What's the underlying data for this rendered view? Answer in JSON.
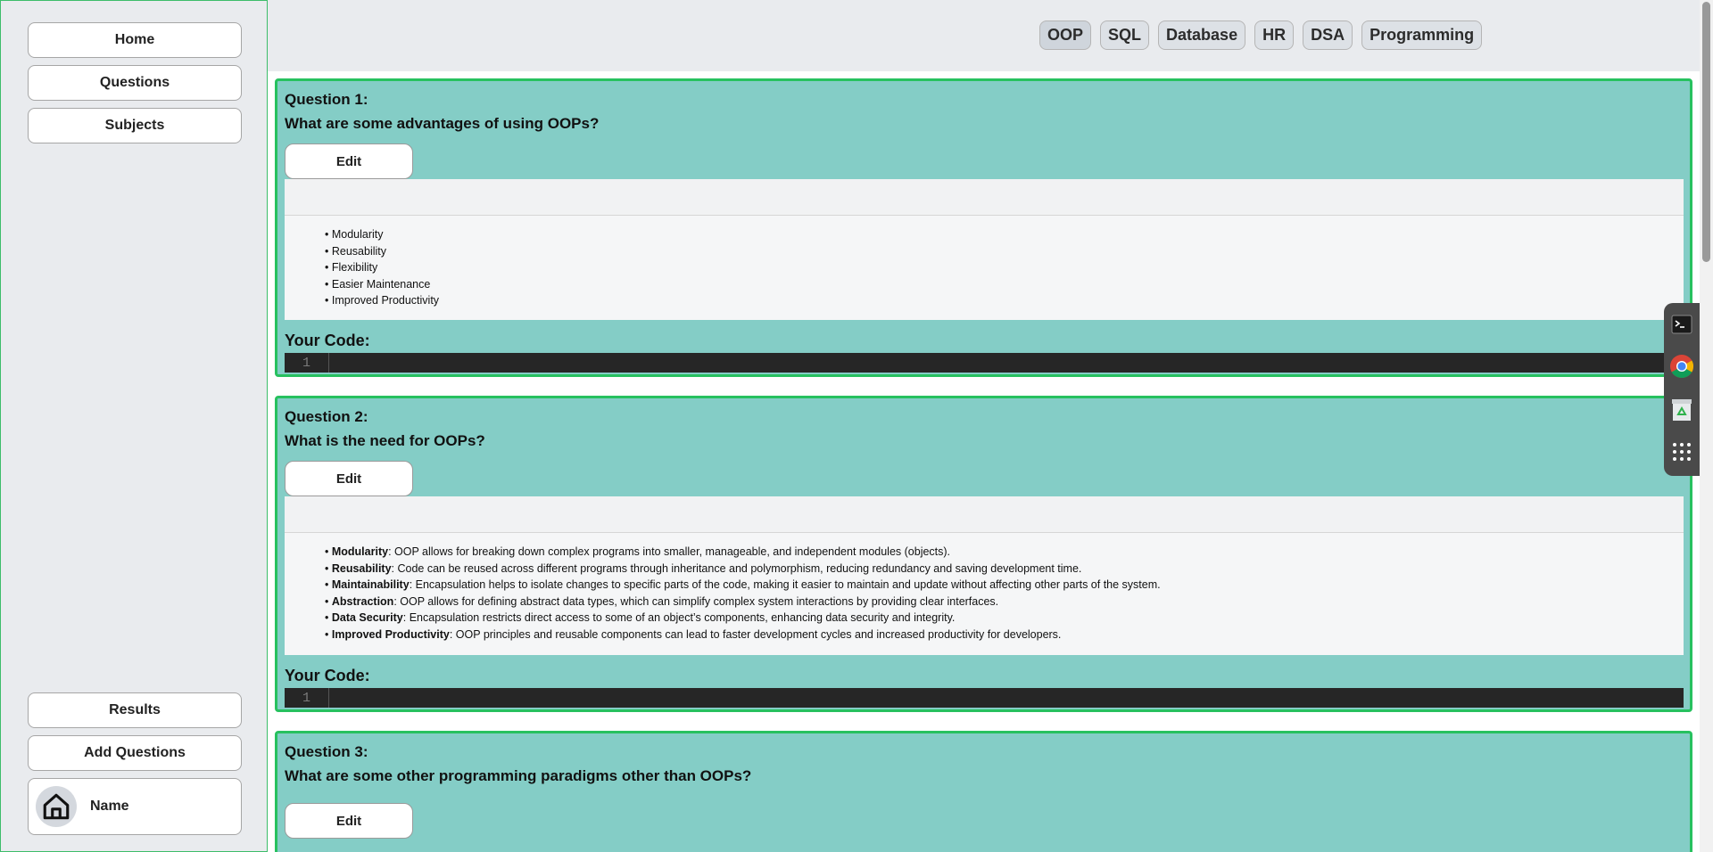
{
  "sidebar": {
    "top_items": [
      "Home",
      "Questions",
      "Subjects"
    ],
    "bottom_items": [
      "Results",
      "Add Questions"
    ],
    "profile": {
      "name": "Name",
      "icon": "home-icon"
    }
  },
  "subject_tabs": {
    "items": [
      "OOP",
      "SQL",
      "Database",
      "HR",
      "DSA",
      "Programming"
    ],
    "active": "OOP"
  },
  "questions": [
    {
      "title": "Question 1:",
      "text": "What are some advantages of using OOPs?",
      "edit_label": "Edit",
      "answers": [
        {
          "term": "",
          "desc": "Modularity"
        },
        {
          "term": "",
          "desc": "Reusability"
        },
        {
          "term": "",
          "desc": "Flexibility"
        },
        {
          "term": "",
          "desc": "Easier Maintenance"
        },
        {
          "term": "",
          "desc": "Improved Productivity"
        }
      ],
      "code_label": "Your Code:",
      "line_number": "1"
    },
    {
      "title": "Question 2:",
      "text": "What is the need for OOPs?",
      "edit_label": "Edit",
      "answers": [
        {
          "term": "Modularity",
          "desc": ": OOP allows for breaking down complex programs into smaller, manageable, and independent modules (objects)."
        },
        {
          "term": "Reusability",
          "desc": ": Code can be reused across different programs through inheritance and polymorphism, reducing redundancy and saving development time."
        },
        {
          "term": "Maintainability",
          "desc": ": Encapsulation helps to isolate changes to specific parts of the code, making it easier to maintain and update without affecting other parts of the system."
        },
        {
          "term": "Abstraction",
          "desc": ": OOP allows for defining abstract data types, which can simplify complex system interactions by providing clear interfaces."
        },
        {
          "term": "Data Security",
          "desc": ": Encapsulation restricts direct access to some of an object’s components, enhancing data security and integrity."
        },
        {
          "term": "Improved Productivity",
          "desc": ": OOP principles and reusable components can lead to faster development cycles and increased productivity for developers."
        }
      ],
      "code_label": "Your Code:",
      "line_number": "1"
    },
    {
      "title": "Question 3:",
      "text": "What are some other programming paradigms other than OOPs?",
      "edit_label": "Edit"
    }
  ],
  "dock": [
    "terminal-icon",
    "chrome-icon",
    "trash-icon",
    "app-grid-icon"
  ],
  "colors": {
    "card_bg": "#84cdc6",
    "card_border": "#27c15f",
    "code_bg": "#262626",
    "page_bg": "#e9ebee"
  }
}
